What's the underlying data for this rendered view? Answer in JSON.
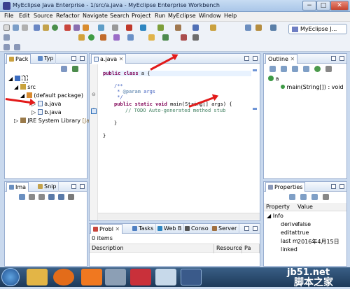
{
  "window": {
    "title": "MyEclipse Java Enterprise - 1/src/a.java - MyEclipse Enterprise Workbench",
    "min": "−",
    "max": "□",
    "close": "✕"
  },
  "menu": [
    "File",
    "Edit",
    "Source",
    "Refactor",
    "Navigate",
    "Search",
    "Project",
    "Run",
    "MyEclipse",
    "Window",
    "Help"
  ],
  "perspective": {
    "label": "MyEclipse J..."
  },
  "left_top": {
    "tabs": [
      "Pack",
      "Typ"
    ],
    "tree": {
      "project": "1",
      "src": "src",
      "package": "(default package)",
      "file_a": "a.java",
      "file_b": "b.java",
      "jre": "JRE System Library",
      "jre_suffix": "[Ja"
    }
  },
  "left_bottom": {
    "tabs": [
      "Ima",
      "Snip"
    ]
  },
  "editor": {
    "tab": "a.java",
    "lines": {
      "l1_kw": "public class ",
      "l1_rest": "a {",
      "l2": "/**",
      "l3_a": " * ",
      "l3_b": "@param",
      "l3_c": " args",
      "l4": " */",
      "l5_kw": "public static void ",
      "l5_rest": "main(String[] args) {",
      "l6": "// TODO Auto-generated method stub",
      "l7": "}",
      "l8": "}"
    }
  },
  "outline": {
    "tab": "Outline",
    "class": "a",
    "method": "main(String[]) : void"
  },
  "properties": {
    "tab": "Properties",
    "cols": [
      "Property",
      "Value"
    ],
    "category": "Info",
    "rows": [
      {
        "k": "derive",
        "v": "false"
      },
      {
        "k": "editat",
        "v": "true"
      },
      {
        "k": "last m",
        "v": "2016年4月15日"
      },
      {
        "k": "linked",
        "v": ""
      }
    ]
  },
  "problems": {
    "tabs": [
      "Probl",
      "Tasks",
      "Web B",
      "Conso",
      "Server"
    ],
    "count": "0 items",
    "cols": [
      "Description",
      "Resource",
      "Pa"
    ]
  },
  "watermark": {
    "site": "jb51.net",
    "name": "脚本之家"
  },
  "colors": {
    "arrow": "#e21a1a",
    "keyword": "#7f0055",
    "comment": "#3f7f5f",
    "javadoc": "#3f5fbf"
  }
}
